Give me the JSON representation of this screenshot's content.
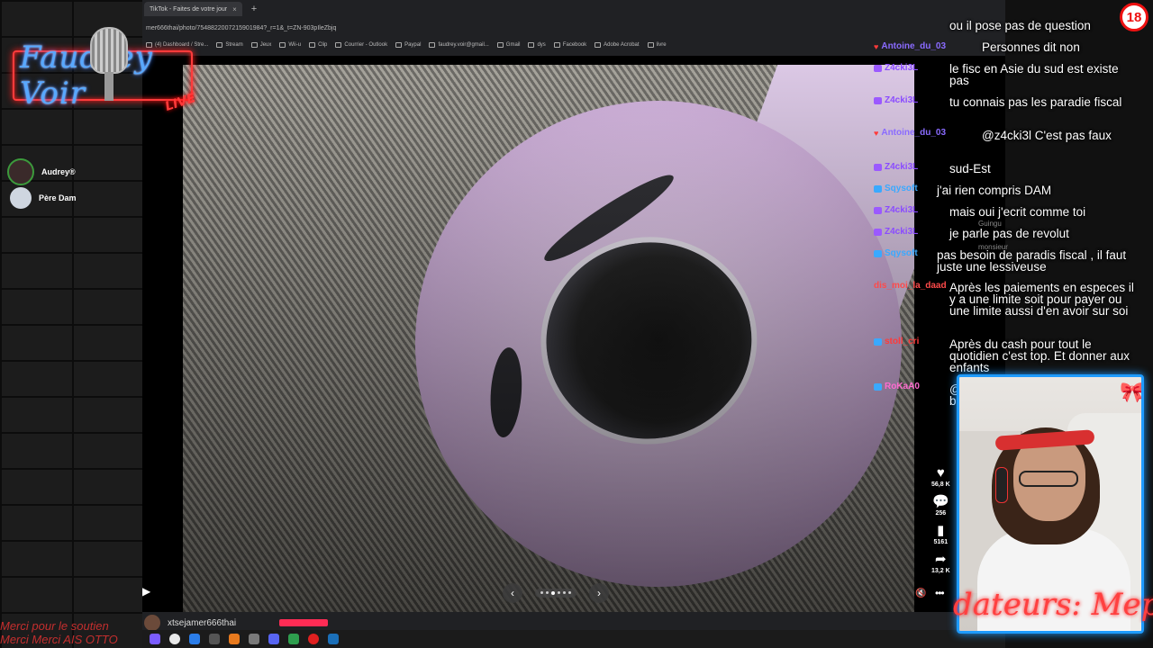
{
  "stream": {
    "logo_text": "Faudrey Voir",
    "logo_live": "LIVE",
    "bottom_scroll_1": "Merci pour le soutien",
    "bottom_scroll_2": "Merci Merci AIS OTTO",
    "age_rating": "18",
    "cam_overlay": "dateurs: Meph",
    "presence": [
      {
        "name": "Audrey®"
      },
      {
        "name": "Père Dam"
      }
    ]
  },
  "browser": {
    "tab_title": "TikTok - Faites de votre jour",
    "tab_close": "×",
    "new_tab": "+",
    "url": "mer666thai/photo/7548822007215901984?_r=1&_t=ZN-903pIleZbjq",
    "bookmarks": [
      "(4) Dashboard / Stre...",
      "Stream",
      "Jeux",
      "Wii-u",
      "Clip",
      "Courrier - Outlook",
      "Paypal",
      "faudrey.voir@gmail...",
      "Gmail",
      "dys",
      "Facebook",
      "Adobe Acrobat",
      "livre"
    ]
  },
  "viewer": {
    "play_icon": "▶",
    "prev_icon": "‹",
    "next_icon": "›",
    "slide_count": 6,
    "active_slide": 2,
    "likes": "56,8 K",
    "comments": "256",
    "saves": "5161",
    "shares": "13,2 K",
    "mute_icon": "🔇",
    "more_icon": "•••",
    "author_name": "xtsejamer666thai"
  },
  "chat": {
    "messages": [
      {
        "user": "",
        "text": "ou il pose pas de question",
        "color": "#ffffff",
        "badge": ""
      },
      {
        "user": "Antoine_du_03",
        "text": "Personnes dit non",
        "color": "#8a6bff",
        "badge": "heart"
      },
      {
        "user": "Z4cki3L",
        "text": "le fisc en Asie du sud est existe pas",
        "color": "#8a4bff",
        "badge": "mod"
      },
      {
        "user": "Z4cki3L",
        "text": "tu connais pas les paradie fiscal",
        "color": "#8a4bff",
        "badge": "mod"
      },
      {
        "user": "Antoine_du_03",
        "text": "@z4cki3l C'est pas faux",
        "color": "#8a6bff",
        "badge": "heart"
      },
      {
        "user": "Z4cki3L",
        "text": "sud-Est",
        "color": "#8a4bff",
        "badge": "mod"
      },
      {
        "user": "Sqysoft",
        "text": "j'ai rien compris DAM",
        "color": "#3aa9ff",
        "badge": "sub"
      },
      {
        "user": "Z4cki3L",
        "text": "mais oui j'ecrit comme toi",
        "color": "#8a4bff",
        "badge": "mod"
      },
      {
        "user": "Z4cki3L",
        "text": "je parle pas de revolut",
        "color": "#8a4bff",
        "badge": "mod"
      },
      {
        "user": "Sqysoft",
        "text": "pas besoin de paradis fiscal , il faut juste une lessiveuse",
        "color": "#3aa9ff",
        "badge": "sub"
      },
      {
        "user": "dis_moi_la_daad",
        "text": "Après les paiements en especes il y a une limite soit pour payer ou une limite aussi d'en avoir sur soi",
        "color": "#ff4a4a",
        "badge": ""
      },
      {
        "user": "stoll_cri",
        "text": "Après du cash pour tout le quotidien c'est top. Et donner aux enfants",
        "color": "#ff3a3a",
        "badge": "sub"
      },
      {
        "user": "RoKaA0",
        "text": "@faudrey_voir revolut app bancaire",
        "color": "#ff6bd0",
        "badge": "sub"
      }
    ],
    "ghost_1": "Guingu",
    "ghost_2": "monsieur"
  }
}
